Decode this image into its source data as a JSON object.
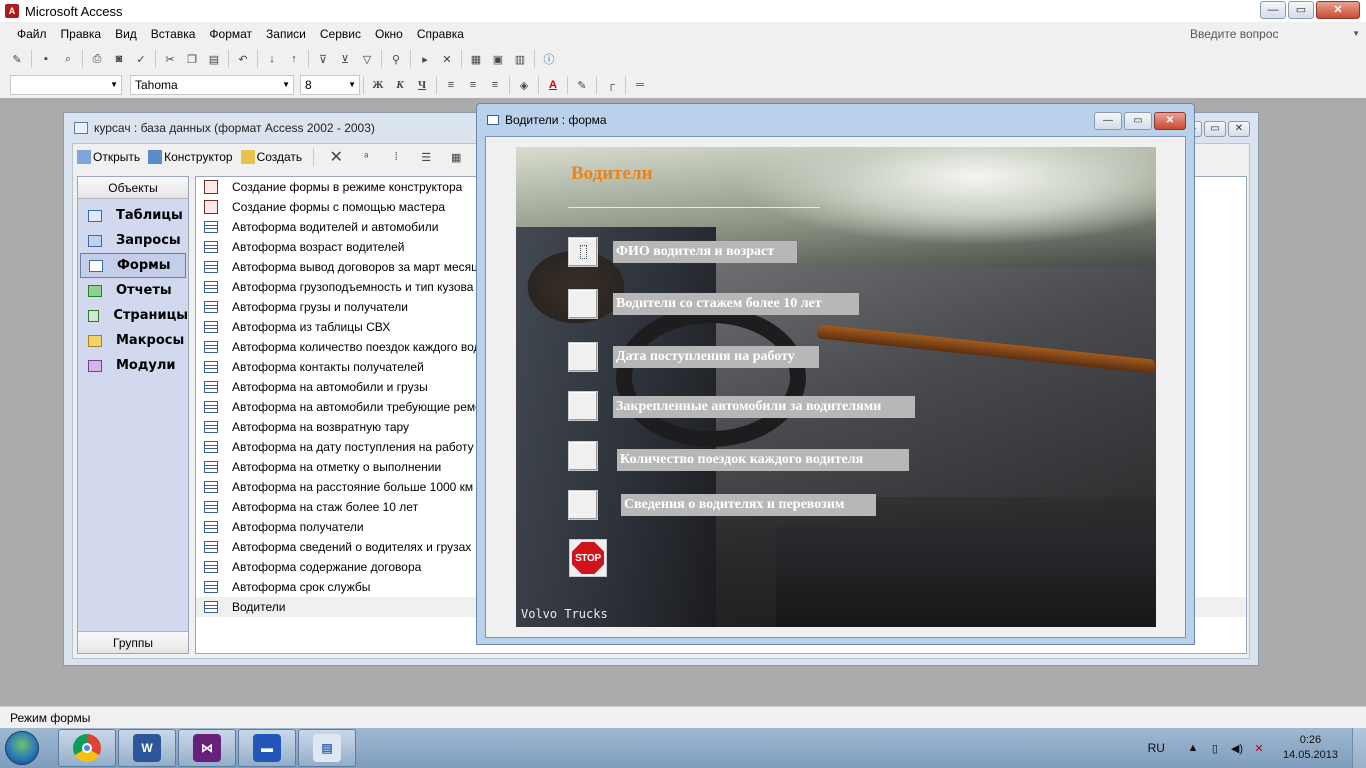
{
  "app": {
    "title": "Microsoft Access"
  },
  "menu": {
    "items": [
      "Файл",
      "Правка",
      "Вид",
      "Вставка",
      "Формат",
      "Записи",
      "Сервис",
      "Окно",
      "Справка"
    ],
    "help_placeholder": "Введите вопрос"
  },
  "format_toolbar": {
    "object_value": "",
    "font_name": "Tahoma",
    "font_size": "8",
    "bold_label": "Ж",
    "italic_label": "К",
    "underline_label": "Ч"
  },
  "db_window": {
    "title": "курсач : база данных (формат Access 2002 - 2003)",
    "toolbar": {
      "open": "Открыть",
      "design": "Конструктор",
      "create": "Создать"
    },
    "objects_header": "Объекты",
    "groups_footer": "Группы",
    "objects": [
      {
        "label": "Таблицы",
        "icon": "table-icon"
      },
      {
        "label": "Запросы",
        "icon": "query-icon"
      },
      {
        "label": "Формы",
        "icon": "form-icon"
      },
      {
        "label": "Отчеты",
        "icon": "report-icon"
      },
      {
        "label": "Страницы",
        "icon": "page-icon"
      },
      {
        "label": "Макросы",
        "icon": "macro-icon"
      },
      {
        "label": "Модули",
        "icon": "module-icon"
      }
    ],
    "items": [
      "Создание формы в режиме конструктора",
      "Создание формы с помощью мастера",
      "Автоформа водителей и автомобили",
      "Автоформа возраст водителей",
      "Автоформа вывод договоров за март месяц",
      "Автоформа грузоподъемность и тип кузова",
      "Автоформа грузы и получатели",
      "Автоформа из таблицы СВХ",
      "Автоформа количество поездок каждого водителя",
      "Автоформа контакты получателей",
      "Автоформа на автомобили и грузы",
      "Автоформа на автомобили требующие ремонта",
      "Автоформа на возвратную тару",
      "Автоформа на дату поступления на работу",
      "Автоформа на отметку о выполнении",
      "Автоформа на расстояние больше 1000 км",
      "Автоформа на стаж более 10 лет",
      "Автоформа получатели",
      "Автоформа сведений о водителях и грузах",
      "Автоформа содержание договора",
      "Автоформа срок службы",
      "Водители"
    ]
  },
  "form_window": {
    "title": "Водители : форма",
    "heading": "Водители",
    "buttons": [
      "ФИО водителя и возраст",
      "Водители со стажем более 10 лет",
      "Дата поступления на работу",
      "Закрепленные автомобили за водителями",
      "Количество поездок каждого водителя",
      "Сведения о водителях и перевозим"
    ],
    "stop_label": "STOP",
    "watermark": "Volvo Trucks"
  },
  "status": {
    "text": "Режим формы"
  },
  "taskbar": {
    "apps": [
      "chrome",
      "word",
      "visual-studio",
      "access",
      "windows-explorer"
    ],
    "lang": "RU",
    "time": "0:26",
    "date": "14.05.2013"
  },
  "colors": {
    "form_heading": "#e8841e",
    "label_bg": "#b7b7b7",
    "stop_red": "#d0121b"
  }
}
